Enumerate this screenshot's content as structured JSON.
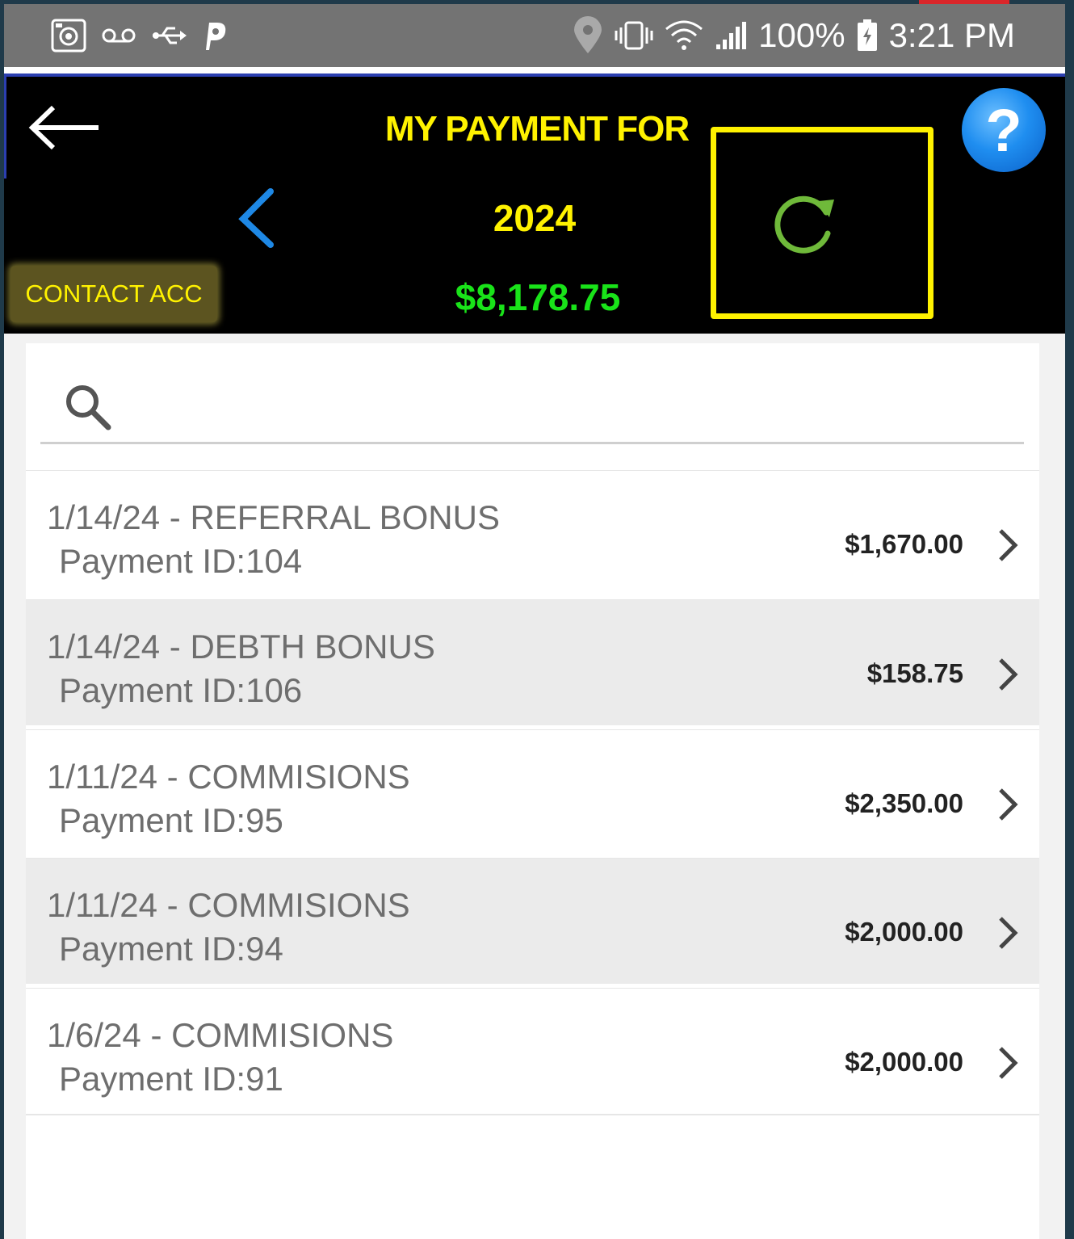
{
  "status_bar": {
    "battery": "100%",
    "time": "3:21 PM"
  },
  "header": {
    "title": "MY PAYMENT FOR",
    "help_symbol": "?"
  },
  "year_nav": {
    "year": "2024"
  },
  "summary": {
    "contact_label": "CONTACT ACC",
    "total": "$8,178.75"
  },
  "search": {
    "placeholder": "",
    "value": ""
  },
  "payments": [
    {
      "title": "1/14/24 - REFERRAL BONUS",
      "id_text": "Payment ID:104",
      "amount": "$1,670.00"
    },
    {
      "title": "1/14/24 - DEBTH BONUS",
      "id_text": "Payment ID:106",
      "amount": "$158.75"
    },
    {
      "title": "1/11/24 - COMMISIONS",
      "id_text": "Payment ID:95",
      "amount": "$2,350.00"
    },
    {
      "title": "1/11/24 - COMMISIONS",
      "id_text": "Payment ID:94",
      "amount": "$2,000.00"
    },
    {
      "title": "1/6/24 - COMMISIONS",
      "id_text": "Payment ID:91",
      "amount": "$2,000.00"
    }
  ],
  "colors": {
    "title_yellow": "#fff200",
    "total_green": "#19e319",
    "refresh_green": "#6fb93a",
    "prev_blue": "#1e88e5",
    "highlight": "#fff200"
  },
  "icons": [
    "camera-icon",
    "voicemail-icon",
    "usb-icon",
    "parking-icon",
    "location-icon",
    "vibrate-icon",
    "wifi-icon",
    "signal-icon",
    "battery-icon",
    "back-arrow-icon",
    "help-icon",
    "chevron-left-icon",
    "refresh-icon",
    "search-icon",
    "chevron-right-icon"
  ]
}
